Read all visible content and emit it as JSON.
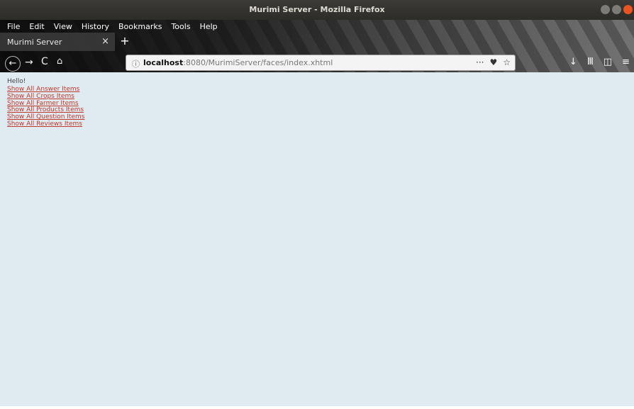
{
  "window": {
    "title": "Murimi Server - Mozilla Firefox"
  },
  "menu": {
    "items": [
      "File",
      "Edit",
      "View",
      "History",
      "Bookmarks",
      "Tools",
      "Help"
    ]
  },
  "tab": {
    "label": "Murimi Server",
    "close": "×",
    "new_tab": "+"
  },
  "nav": {
    "back": "←",
    "forward": "→",
    "reload": "C",
    "home": "⌂"
  },
  "urlbar": {
    "info_icon": "ⓘ",
    "host": "localhost",
    "rest": ":8080/MurimiServer/faces/index.xhtml",
    "more": "···",
    "pocket": "♥",
    "bookmark": "☆"
  },
  "toolbar_right": {
    "download": "↓",
    "library": "Ⅲ",
    "sidebar": "◫",
    "menu": "≡"
  },
  "page": {
    "greeting": "Hello!",
    "links": [
      "Show All Answer Items",
      "Show All Crops Items",
      "Show All Farmer Items",
      "Show All Products Items",
      "Show All Question Items",
      "Show All Reviews Items"
    ]
  },
  "colors": {
    "link": "#c0392b",
    "content_bg": "#dfeaf1",
    "close_button": "#e95420"
  }
}
